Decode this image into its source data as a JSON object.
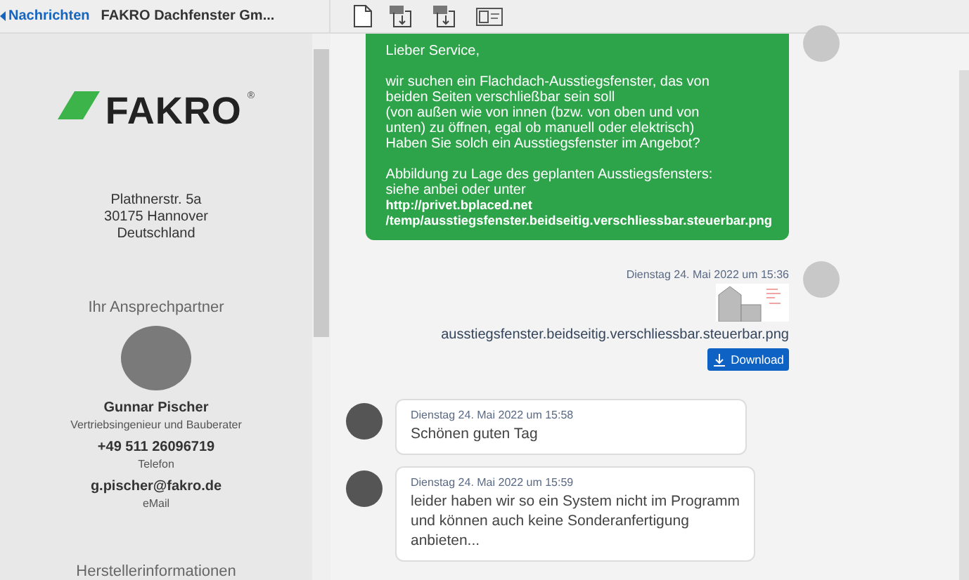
{
  "header": {
    "back_label": "Nachrichten",
    "title": "FAKRO Dachfenster Gm...",
    "toolbar_icons": [
      {
        "kind": "document"
      },
      {
        "kind": "pdf"
      },
      {
        "kind": "csv"
      },
      {
        "kind": "vcard"
      }
    ]
  },
  "sidebar": {
    "logo": {
      "text": "FAKRO",
      "mark": "®"
    },
    "address": [
      "Plathnerstr. 5a",
      "30175 Hannover",
      "Deutschland"
    ],
    "contact_heading": "Ihr Ansprechpartner",
    "contact": {
      "name": "Gunnar Pischer",
      "role": "Vertriebsingenieur und Bauberater",
      "phone": "+49 511 26096719",
      "phone_label": "Telefon",
      "email": "g.pischer@fakro.de",
      "email_label": "eMail"
    },
    "section_heading": "Herstellerinformationen"
  },
  "messages": [
    {
      "kind": "outgoing",
      "paragraphs": [
        "Lieber Service,",
        "wir suchen ein Flachdach-Ausstiegsfenster, das von\nbeiden Seiten verschließbar sein soll\n(von außen wie von innen (bzw. von oben und von\nunten) zu öffnen, egal ob manuell oder elektrisch)\nHaben Sie solch ein Ausstiegsfenster im Angebot?",
        "Abbildung zu Lage des geplanten Ausstiegsfensters:\nsiehe anbei oder unter"
      ],
      "links": [
        "http://privet.bplaced.net",
        "/temp/ausstiegsfenster.beidseitig.verschliessbar.steuerbar.png"
      ]
    },
    {
      "kind": "attachment",
      "timestamp": "Dienstag 24. Mai 2022 um 15:36",
      "filename": "ausstiegsfenster.beidseitig.verschliessbar.steuerbar.png",
      "button": "Download"
    },
    {
      "kind": "incoming",
      "timestamp": "Dienstag 24. Mai 2022 um 15:58",
      "text": "Schönen guten Tag"
    },
    {
      "kind": "incoming",
      "timestamp": "Dienstag 24. Mai 2022 um 15:59",
      "text": "leider haben wir so ein System nicht im Programm\nund können auch keine Sonderanfertigung\nanbieten..."
    }
  ]
}
